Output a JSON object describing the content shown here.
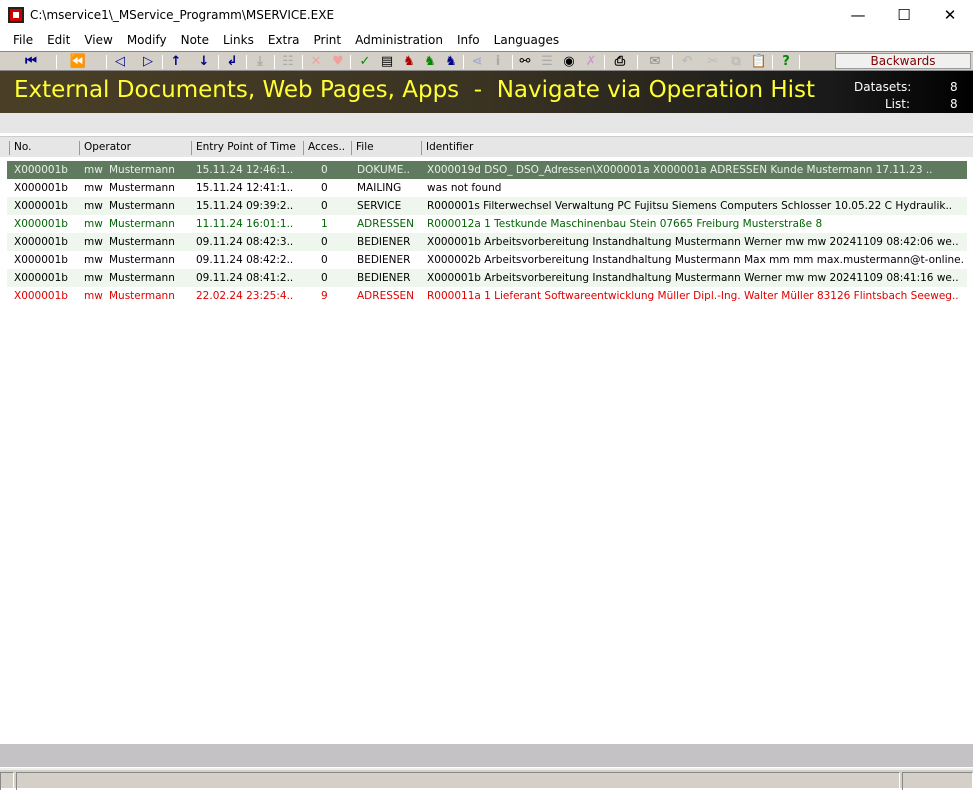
{
  "window": {
    "title": "C:\\mservice1\\_MService_Programm\\MSERVICE.EXE",
    "minimize": "—",
    "maximize": "☐",
    "close": "✕"
  },
  "menu": [
    "File",
    "Edit",
    "View",
    "Modify",
    "Note",
    "Links",
    "Extra",
    "Print",
    "Administration",
    "Info",
    "Languages"
  ],
  "toolbar": {
    "backwards_label": "Backwards"
  },
  "banner": {
    "title": "External Documents, Web Pages, Apps  -  Navigate via Operation Hist",
    "datasets_label": "Datasets:",
    "datasets_value": "8",
    "list_label": "List:",
    "list_value": "8"
  },
  "columns": [
    "No.",
    "Operator",
    "Entry Point of Time",
    "Acces..",
    "File",
    "Identifier"
  ],
  "rows": [
    {
      "no": "X000001b",
      "op_short": "mw",
      "op": "Mustermann",
      "time": "15.11.24  12:46:1..",
      "access": "0",
      "file": "DOKUME..",
      "identifier": "X000019d  DSO_  DSO_Adressen\\X000001a  X000001a  ADRESSEN  Kunde  Mustermann  17.11.23 .."
    },
    {
      "no": "X000001b",
      "op_short": "mw",
      "op": "Mustermann",
      "time": "15.11.24  12:41:1..",
      "access": "0",
      "file": "MAILING",
      "identifier": "was not found"
    },
    {
      "no": "X000001b",
      "op_short": "mw",
      "op": "Mustermann",
      "time": "15.11.24  09:39:2..",
      "access": "0",
      "file": "SERVICE",
      "identifier": "R000001s  Filterwechsel  Verwaltung  PC Fujitsu Siemens Computers  Schlosser  10.05.22  C  Hydraulik.."
    },
    {
      "no": "X000001b",
      "op_short": "mw",
      "op": "Mustermann",
      "time": "11.11.24  16:01:1..",
      "access": "1",
      "file": "ADRESSEN",
      "identifier": "R000012a  1  Testkunde  Maschinenbau  Stein  07665  Freiburg  Musterstraße 8"
    },
    {
      "no": "X000001b",
      "op_short": "mw",
      "op": "Mustermann",
      "time": "09.11.24  08:42:3..",
      "access": "0",
      "file": "BEDIENER",
      "identifier": "X000001b  Arbeitsvorbereitung  Instandhaltung  Mustermann  Werner  mw  mw  20241109 08:42:06  we.."
    },
    {
      "no": "X000001b",
      "op_short": "mw",
      "op": "Mustermann",
      "time": "09.11.24  08:42:2..",
      "access": "0",
      "file": "BEDIENER",
      "identifier": "X000002b  Arbeitsvorbereitung  Instandhaltung  Mustermann  Max  mm  mm  max.mustermann@t-online.."
    },
    {
      "no": "X000001b",
      "op_short": "mw",
      "op": "Mustermann",
      "time": "09.11.24  08:41:2..",
      "access": "0",
      "file": "BEDIENER",
      "identifier": "X000001b  Arbeitsvorbereitung  Instandhaltung  Mustermann  Werner  mw  mw  20241109 08:41:16  we.."
    },
    {
      "no": "X000001b",
      "op_short": "mw",
      "op": "Mustermann",
      "time": "22.02.24  23:25:4..",
      "access": "9",
      "file": "ADRESSEN",
      "identifier": "R000011a  1  Lieferant  Softwareentwicklung  Müller  Dipl.-Ing. Walter Müller  83126  Flintsbach  Seeweg.."
    }
  ],
  "colors": {
    "selected_row": "#5f7a5f",
    "alt_row": "#eef6ee",
    "banner_text": "#ffff33",
    "green_text": "#006400",
    "red_text": "#e00000"
  }
}
